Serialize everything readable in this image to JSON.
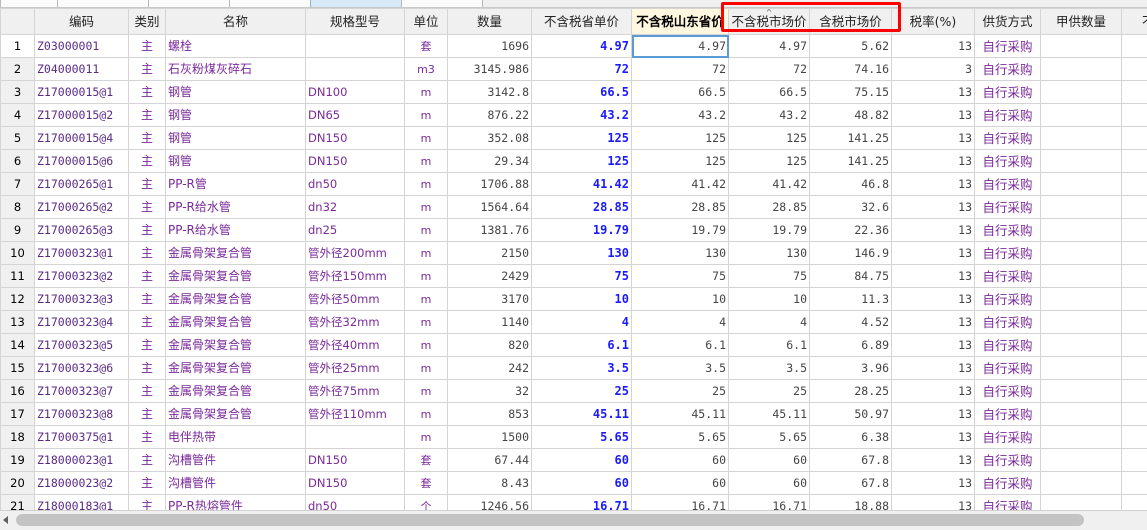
{
  "columns": [
    "编码",
    "类别",
    "名称",
    "规格型号",
    "单位",
    "数量",
    "不含税省单价",
    "不含税山东省价",
    "不含税市场价",
    "含税市场价",
    "税率(%)",
    "供货方式",
    "甲供数量",
    "不含"
  ],
  "rows": [
    {
      "n": "1",
      "code": "Z03000001",
      "cat": "主",
      "name": "螺栓",
      "spec": "",
      "unit": "套",
      "qty": "1696",
      "p1": "4.97",
      "p2": "4.97",
      "p3": "4.97",
      "p4": "5.62",
      "tax": "13",
      "supply": "自行采购"
    },
    {
      "n": "2",
      "code": "Z04000011",
      "cat": "主",
      "name": "石灰粉煤灰碎石",
      "spec": "",
      "unit": "m3",
      "qty": "3145.986",
      "p1": "72",
      "p2": "72",
      "p3": "72",
      "p4": "74.16",
      "tax": "3",
      "supply": "自行采购"
    },
    {
      "n": "3",
      "code": "Z17000015@1",
      "cat": "主",
      "name": "钢管",
      "spec": "DN100",
      "unit": "m",
      "qty": "3142.8",
      "p1": "66.5",
      "p2": "66.5",
      "p3": "66.5",
      "p4": "75.15",
      "tax": "13",
      "supply": "自行采购"
    },
    {
      "n": "4",
      "code": "Z17000015@2",
      "cat": "主",
      "name": "钢管",
      "spec": "DN65",
      "unit": "m",
      "qty": "876.22",
      "p1": "43.2",
      "p2": "43.2",
      "p3": "43.2",
      "p4": "48.82",
      "tax": "13",
      "supply": "自行采购"
    },
    {
      "n": "5",
      "code": "Z17000015@4",
      "cat": "主",
      "name": "钢管",
      "spec": "DN150",
      "unit": "m",
      "qty": "352.08",
      "p1": "125",
      "p2": "125",
      "p3": "125",
      "p4": "141.25",
      "tax": "13",
      "supply": "自行采购"
    },
    {
      "n": "6",
      "code": "Z17000015@6",
      "cat": "主",
      "name": "钢管",
      "spec": "DN150",
      "unit": "m",
      "qty": "29.34",
      "p1": "125",
      "p2": "125",
      "p3": "125",
      "p4": "141.25",
      "tax": "13",
      "supply": "自行采购"
    },
    {
      "n": "7",
      "code": "Z17000265@1",
      "cat": "主",
      "name": "PP-R管",
      "spec": "dn50",
      "unit": "m",
      "qty": "1706.88",
      "p1": "41.42",
      "p2": "41.42",
      "p3": "41.42",
      "p4": "46.8",
      "tax": "13",
      "supply": "自行采购"
    },
    {
      "n": "8",
      "code": "Z17000265@2",
      "cat": "主",
      "name": "PP-R给水管",
      "spec": "dn32",
      "unit": "m",
      "qty": "1564.64",
      "p1": "28.85",
      "p2": "28.85",
      "p3": "28.85",
      "p4": "32.6",
      "tax": "13",
      "supply": "自行采购"
    },
    {
      "n": "9",
      "code": "Z17000265@3",
      "cat": "主",
      "name": "PP-R给水管",
      "spec": "dn25",
      "unit": "m",
      "qty": "1381.76",
      "p1": "19.79",
      "p2": "19.79",
      "p3": "19.79",
      "p4": "22.36",
      "tax": "13",
      "supply": "自行采购"
    },
    {
      "n": "10",
      "code": "Z17000323@1",
      "cat": "主",
      "name": "金属骨架复合管",
      "spec": "管外径200mm",
      "unit": "m",
      "qty": "2150",
      "p1": "130",
      "p2": "130",
      "p3": "130",
      "p4": "146.9",
      "tax": "13",
      "supply": "自行采购"
    },
    {
      "n": "11",
      "code": "Z17000323@2",
      "cat": "主",
      "name": "金属骨架复合管",
      "spec": "管外径150mm",
      "unit": "m",
      "qty": "2429",
      "p1": "75",
      "p2": "75",
      "p3": "75",
      "p4": "84.75",
      "tax": "13",
      "supply": "自行采购"
    },
    {
      "n": "12",
      "code": "Z17000323@3",
      "cat": "主",
      "name": "金属骨架复合管",
      "spec": "管外径50mm",
      "unit": "m",
      "qty": "3170",
      "p1": "10",
      "p2": "10",
      "p3": "10",
      "p4": "11.3",
      "tax": "13",
      "supply": "自行采购"
    },
    {
      "n": "13",
      "code": "Z17000323@4",
      "cat": "主",
      "name": "金属骨架复合管",
      "spec": "管外径32mm",
      "unit": "m",
      "qty": "1140",
      "p1": "4",
      "p2": "4",
      "p3": "4",
      "p4": "4.52",
      "tax": "13",
      "supply": "自行采购"
    },
    {
      "n": "14",
      "code": "Z17000323@5",
      "cat": "主",
      "name": "金属骨架复合管",
      "spec": "管外径40mm",
      "unit": "m",
      "qty": "820",
      "p1": "6.1",
      "p2": "6.1",
      "p3": "6.1",
      "p4": "6.89",
      "tax": "13",
      "supply": "自行采购"
    },
    {
      "n": "15",
      "code": "Z17000323@6",
      "cat": "主",
      "name": "金属骨架复合管",
      "spec": "管外径25mm",
      "unit": "m",
      "qty": "242",
      "p1": "3.5",
      "p2": "3.5",
      "p3": "3.5",
      "p4": "3.96",
      "tax": "13",
      "supply": "自行采购"
    },
    {
      "n": "16",
      "code": "Z17000323@7",
      "cat": "主",
      "name": "金属骨架复合管",
      "spec": "管外径75mm",
      "unit": "m",
      "qty": "32",
      "p1": "25",
      "p2": "25",
      "p3": "25",
      "p4": "28.25",
      "tax": "13",
      "supply": "自行采购"
    },
    {
      "n": "17",
      "code": "Z17000323@8",
      "cat": "主",
      "name": "金属骨架复合管",
      "spec": "管外径110mm",
      "unit": "m",
      "qty": "853",
      "p1": "45.11",
      "p2": "45.11",
      "p3": "45.11",
      "p4": "50.97",
      "tax": "13",
      "supply": "自行采购"
    },
    {
      "n": "18",
      "code": "Z17000375@1",
      "cat": "主",
      "name": "电伴热带",
      "spec": "",
      "unit": "m",
      "qty": "1500",
      "p1": "5.65",
      "p2": "5.65",
      "p3": "5.65",
      "p4": "6.38",
      "tax": "13",
      "supply": "自行采购"
    },
    {
      "n": "19",
      "code": "Z18000023@1",
      "cat": "主",
      "name": "沟槽管件",
      "spec": "DN150",
      "unit": "套",
      "qty": "67.44",
      "p1": "60",
      "p2": "60",
      "p3": "60",
      "p4": "67.8",
      "tax": "13",
      "supply": "自行采购"
    },
    {
      "n": "20",
      "code": "Z18000023@2",
      "cat": "主",
      "name": "沟槽管件",
      "spec": "DN150",
      "unit": "套",
      "qty": "8.43",
      "p1": "60",
      "p2": "60",
      "p3": "60",
      "p4": "67.8",
      "tax": "13",
      "supply": "自行采购"
    },
    {
      "n": "21",
      "code": "Z18000183@1",
      "cat": "主",
      "name": "PP-R热熔管件",
      "spec": "dn50",
      "unit": "个",
      "qty": "1246.56",
      "p1": "16.71",
      "p2": "16.71",
      "p3": "16.71",
      "p4": "18.88",
      "tax": "13",
      "supply": "自行采购"
    }
  ],
  "colors": {
    "accent_red": "#ff0000",
    "price_blue": "#1a1aff",
    "text_purple": "#7a2a9a",
    "header_bg": "#f0f0f0"
  }
}
